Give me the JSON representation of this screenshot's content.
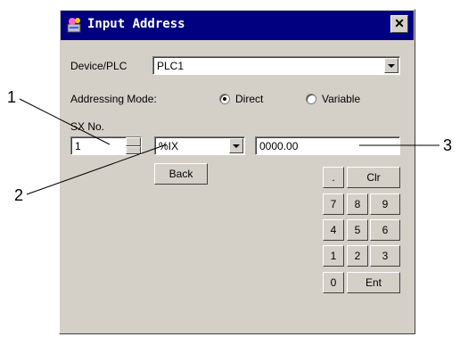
{
  "window": {
    "title": "Input Address"
  },
  "device": {
    "label": "Device/PLC",
    "value": "PLC1"
  },
  "addressing": {
    "label": "Addressing Mode:",
    "direct": "Direct",
    "variable": "Variable",
    "selected": "Direct"
  },
  "sx": {
    "label": "SX No.",
    "value": "1"
  },
  "area": {
    "value": "%IX"
  },
  "address": {
    "value": "0000.00"
  },
  "buttons": {
    "back": "Back",
    "dot": ".",
    "clr": "Clr",
    "k7": "7",
    "k8": "8",
    "k9": "9",
    "k4": "4",
    "k5": "5",
    "k6": "6",
    "k1": "1",
    "k2": "2",
    "k3": "3",
    "k0": "0",
    "ent": "Ent"
  },
  "callouts": {
    "c1": "1",
    "c2": "2",
    "c3": "3"
  }
}
